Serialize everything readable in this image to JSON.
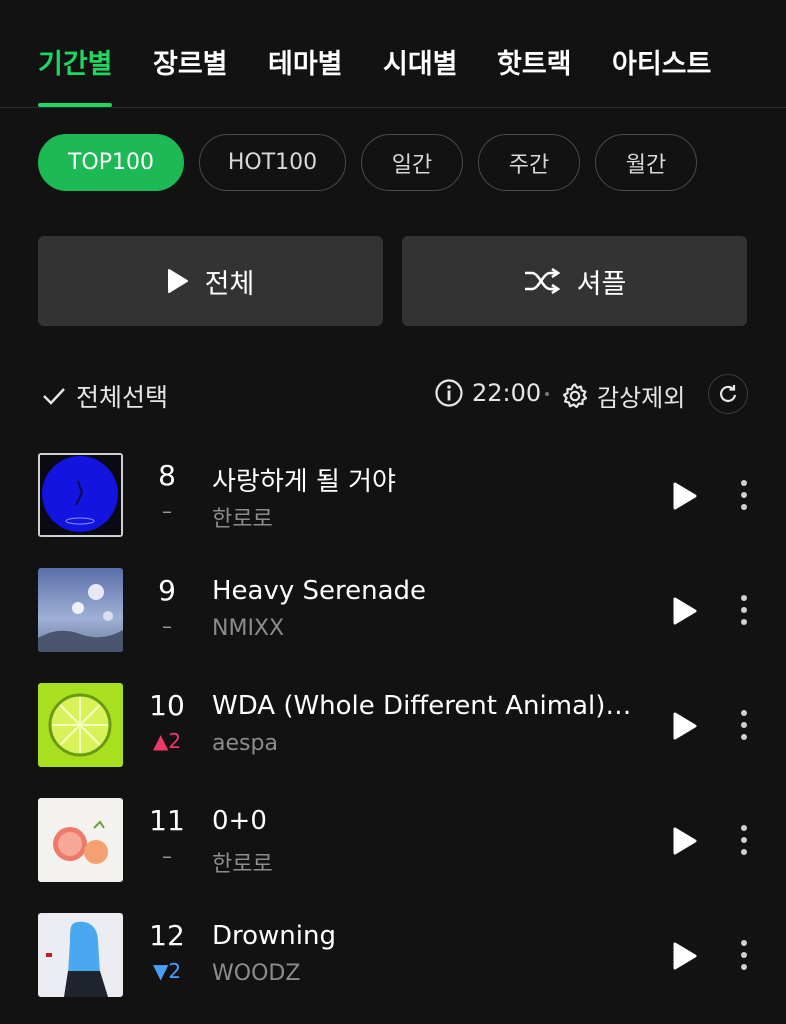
{
  "tabs": [
    {
      "label": "기간별",
      "active": true
    },
    {
      "label": "장르별"
    },
    {
      "label": "테마별"
    },
    {
      "label": "시대별"
    },
    {
      "label": "핫트랙"
    },
    {
      "label": "아티스트"
    }
  ],
  "chips": [
    {
      "label": "TOP100",
      "active": true
    },
    {
      "label": "HOT100"
    },
    {
      "label": "일간"
    },
    {
      "label": "주간"
    },
    {
      "label": "월간"
    }
  ],
  "actions": {
    "play_all": "전체",
    "shuffle": "셔플"
  },
  "toolbar": {
    "select_all": "전체선택",
    "time": "22:00",
    "exclude": "감상제외"
  },
  "colors": {
    "accent": "#1ed760",
    "background": "#121212",
    "rank_up": "#f0386b",
    "rank_down": "#4a9eff"
  },
  "tracks": [
    {
      "rank": "8",
      "change": "–",
      "change_dir": "same",
      "title": "사랑하게 될 거야",
      "artist": "한로로"
    },
    {
      "rank": "9",
      "change": "–",
      "change_dir": "same",
      "title": "Heavy Serenade",
      "artist": "NMIXX"
    },
    {
      "rank": "10",
      "change": "▲2",
      "change_dir": "up",
      "title": "WDA (Whole Different Animal) (…",
      "artist": "aespa"
    },
    {
      "rank": "11",
      "change": "–",
      "change_dir": "same",
      "title": "0+0",
      "artist": "한로로"
    },
    {
      "rank": "12",
      "change": "▼2",
      "change_dir": "down",
      "title": "Drowning",
      "artist": "WOODZ"
    }
  ]
}
